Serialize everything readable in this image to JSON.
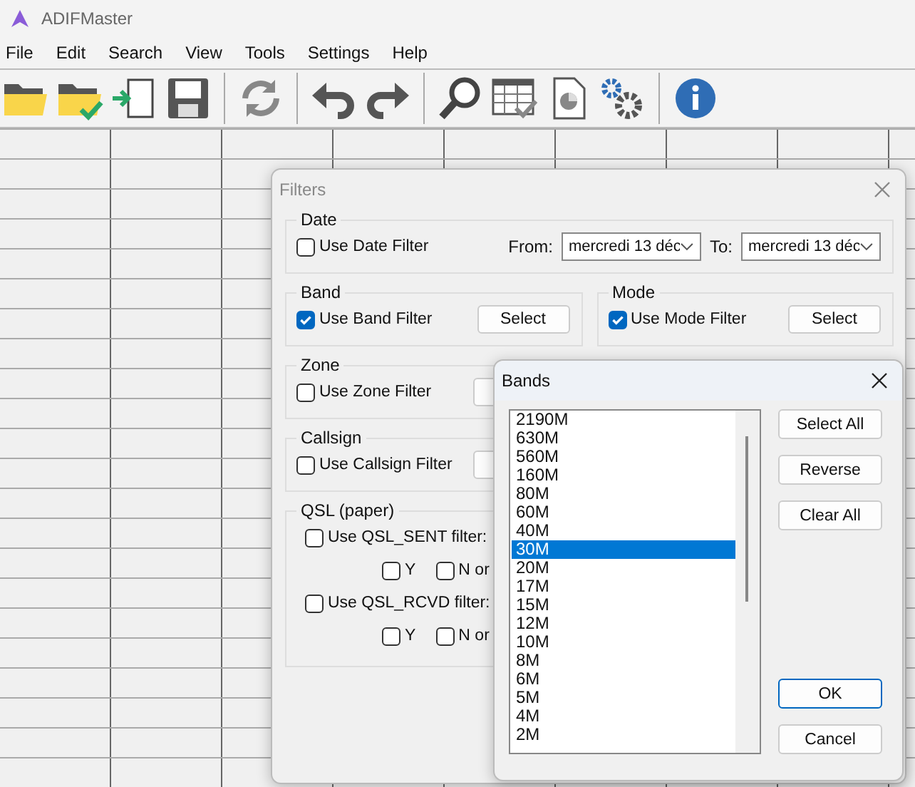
{
  "window": {
    "title": "ADIFMaster"
  },
  "menu": [
    {
      "label": "File"
    },
    {
      "label": "Edit"
    },
    {
      "label": "Search"
    },
    {
      "label": "View"
    },
    {
      "label": "Tools"
    },
    {
      "label": "Settings"
    },
    {
      "label": "Help"
    }
  ],
  "toolbar": [
    {
      "kind": "open"
    },
    {
      "kind": "open-check"
    },
    {
      "kind": "import"
    },
    {
      "kind": "save"
    },
    {
      "kind": "sep"
    },
    {
      "kind": "refresh"
    },
    {
      "kind": "sep"
    },
    {
      "kind": "undo"
    },
    {
      "kind": "redo"
    },
    {
      "kind": "sep"
    },
    {
      "kind": "search"
    },
    {
      "kind": "table-check"
    },
    {
      "kind": "report"
    },
    {
      "kind": "gears"
    },
    {
      "kind": "sep"
    },
    {
      "kind": "info"
    }
  ],
  "filters": {
    "title": "Filters",
    "date": {
      "legend": "Date",
      "checkbox": {
        "label": "Use Date Filter",
        "checked": false
      },
      "from_label": "From:",
      "from_value": "mercredi 13 déc",
      "to_label": "To:",
      "to_value": "mercredi 13 déc"
    },
    "band": {
      "legend": "Band",
      "checkbox": {
        "label": "Use Band Filter",
        "checked": true
      },
      "button": "Select"
    },
    "mode": {
      "legend": "Mode",
      "checkbox": {
        "label": "Use Mode Filter",
        "checked": true
      },
      "button": "Select"
    },
    "zone": {
      "legend": "Zone",
      "checkbox": {
        "label": "Use Zone Filter",
        "checked": false
      }
    },
    "callsign": {
      "legend": "Callsign",
      "checkbox": {
        "label": "Use Callsign Filter",
        "checked": false
      }
    },
    "qsl": {
      "legend": "QSL (paper)",
      "rows": [
        {
          "checkbox": {
            "label": "Use QSL_SENT filter:",
            "checked": false
          },
          "options": [
            {
              "label": "Y",
              "checked": false
            },
            {
              "label": "N or",
              "checked": false
            }
          ]
        },
        {
          "checkbox": {
            "label": "Use QSL_RCVD filter:",
            "checked": false
          },
          "options": [
            {
              "label": "Y",
              "checked": false
            },
            {
              "label": "N or",
              "checked": false
            }
          ]
        }
      ]
    }
  },
  "bands": {
    "title": "Bands",
    "items": [
      {
        "label": "2190M",
        "selected": false
      },
      {
        "label": "630M",
        "selected": false
      },
      {
        "label": "560M",
        "selected": false
      },
      {
        "label": "160M",
        "selected": false
      },
      {
        "label": "80M",
        "selected": false
      },
      {
        "label": "60M",
        "selected": false
      },
      {
        "label": "40M",
        "selected": false
      },
      {
        "label": "30M",
        "selected": true
      },
      {
        "label": "20M",
        "selected": false
      },
      {
        "label": "17M",
        "selected": false
      },
      {
        "label": "15M",
        "selected": false
      },
      {
        "label": "12M",
        "selected": false
      },
      {
        "label": "10M",
        "selected": false
      },
      {
        "label": "8M",
        "selected": false
      },
      {
        "label": "6M",
        "selected": false
      },
      {
        "label": "5M",
        "selected": false
      },
      {
        "label": "4M",
        "selected": false
      },
      {
        "label": "2M",
        "selected": false
      }
    ],
    "side_buttons": [
      "Select All",
      "Reverse",
      "Clear All"
    ],
    "ok": "OK",
    "cancel": "Cancel"
  }
}
